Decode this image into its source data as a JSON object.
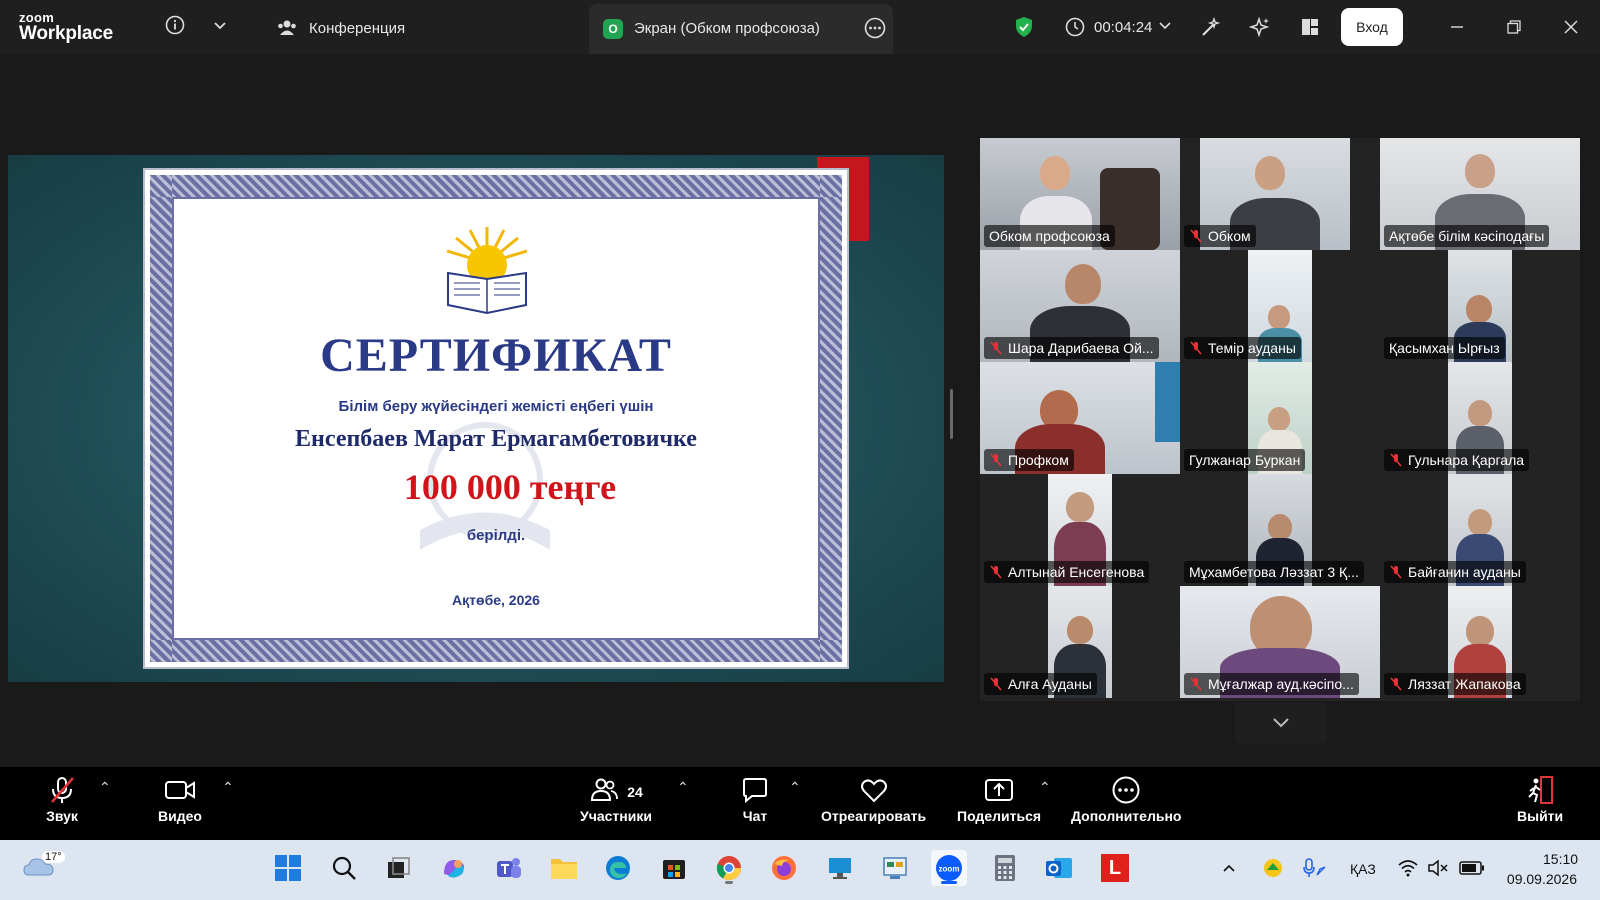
{
  "app": {
    "logo_line1": "zoom",
    "logo_line2": "Workplace"
  },
  "topbar": {
    "conference_label": "Конференция",
    "screen_tab_badge": "O",
    "screen_tab_label": "Экран (Обком профсоюза)",
    "timer": "00:04:24",
    "login_label": "Вход"
  },
  "certificate": {
    "title": "СЕРТИФИКАТ",
    "subtitle": "Білім беру жүйесіндегі жемісті еңбегі үшін",
    "name": "Енсепбаев Марат Ермагамбетовичке",
    "amount": "100 000 теңге",
    "given": "берілді.",
    "place_year": "Ақтөбе, 2026"
  },
  "participants": [
    {
      "name": "Обком профсоюза",
      "muted": false,
      "active": false
    },
    {
      "name": "Обком",
      "muted": true,
      "active": false
    },
    {
      "name": "Ақтөбе білім кәсіподағы",
      "muted": false,
      "active": true
    },
    {
      "name": "Шара Дарибаева Ой...",
      "muted": true,
      "active": false
    },
    {
      "name": "Темір ауданы",
      "muted": true,
      "active": false
    },
    {
      "name": "Қасымхан Ырғыз",
      "muted": false,
      "active": false
    },
    {
      "name": "Профком",
      "muted": true,
      "active": false
    },
    {
      "name": "Гулжанар Буркан",
      "muted": false,
      "active": false
    },
    {
      "name": "Гульнара Қаргала",
      "muted": true,
      "active": false
    },
    {
      "name": "Алтынай Енсегенова",
      "muted": true,
      "active": false
    },
    {
      "name": "Мұхамбетова Ләззат 3 Қ...",
      "muted": false,
      "active": false
    },
    {
      "name": "Байғанин ауданы",
      "muted": true,
      "active": false
    },
    {
      "name": "Алға Ауданы",
      "muted": true,
      "active": false
    },
    {
      "name": "Мұғалжар ауд.кәсіпо...",
      "muted": true,
      "active": false
    },
    {
      "name": "Ляззат Жапакова",
      "muted": true,
      "active": false
    }
  ],
  "toolbar": {
    "audio_label": "Звук",
    "video_label": "Видео",
    "participants_label": "Участники",
    "participants_count": "24",
    "chat_label": "Чат",
    "react_label": "Отреагировать",
    "share_label": "Поделиться",
    "more_label": "Дополнительно",
    "leave_label": "Выйти"
  },
  "taskbar": {
    "weather_temp": "17°",
    "language": "ҚАЗ",
    "time": "15:10",
    "date": "09.09.2026",
    "office_letter": "L"
  },
  "colors": {
    "accent_green": "#2dd069",
    "cert_blue": "#2b3a86",
    "cert_red": "#d0141a"
  }
}
